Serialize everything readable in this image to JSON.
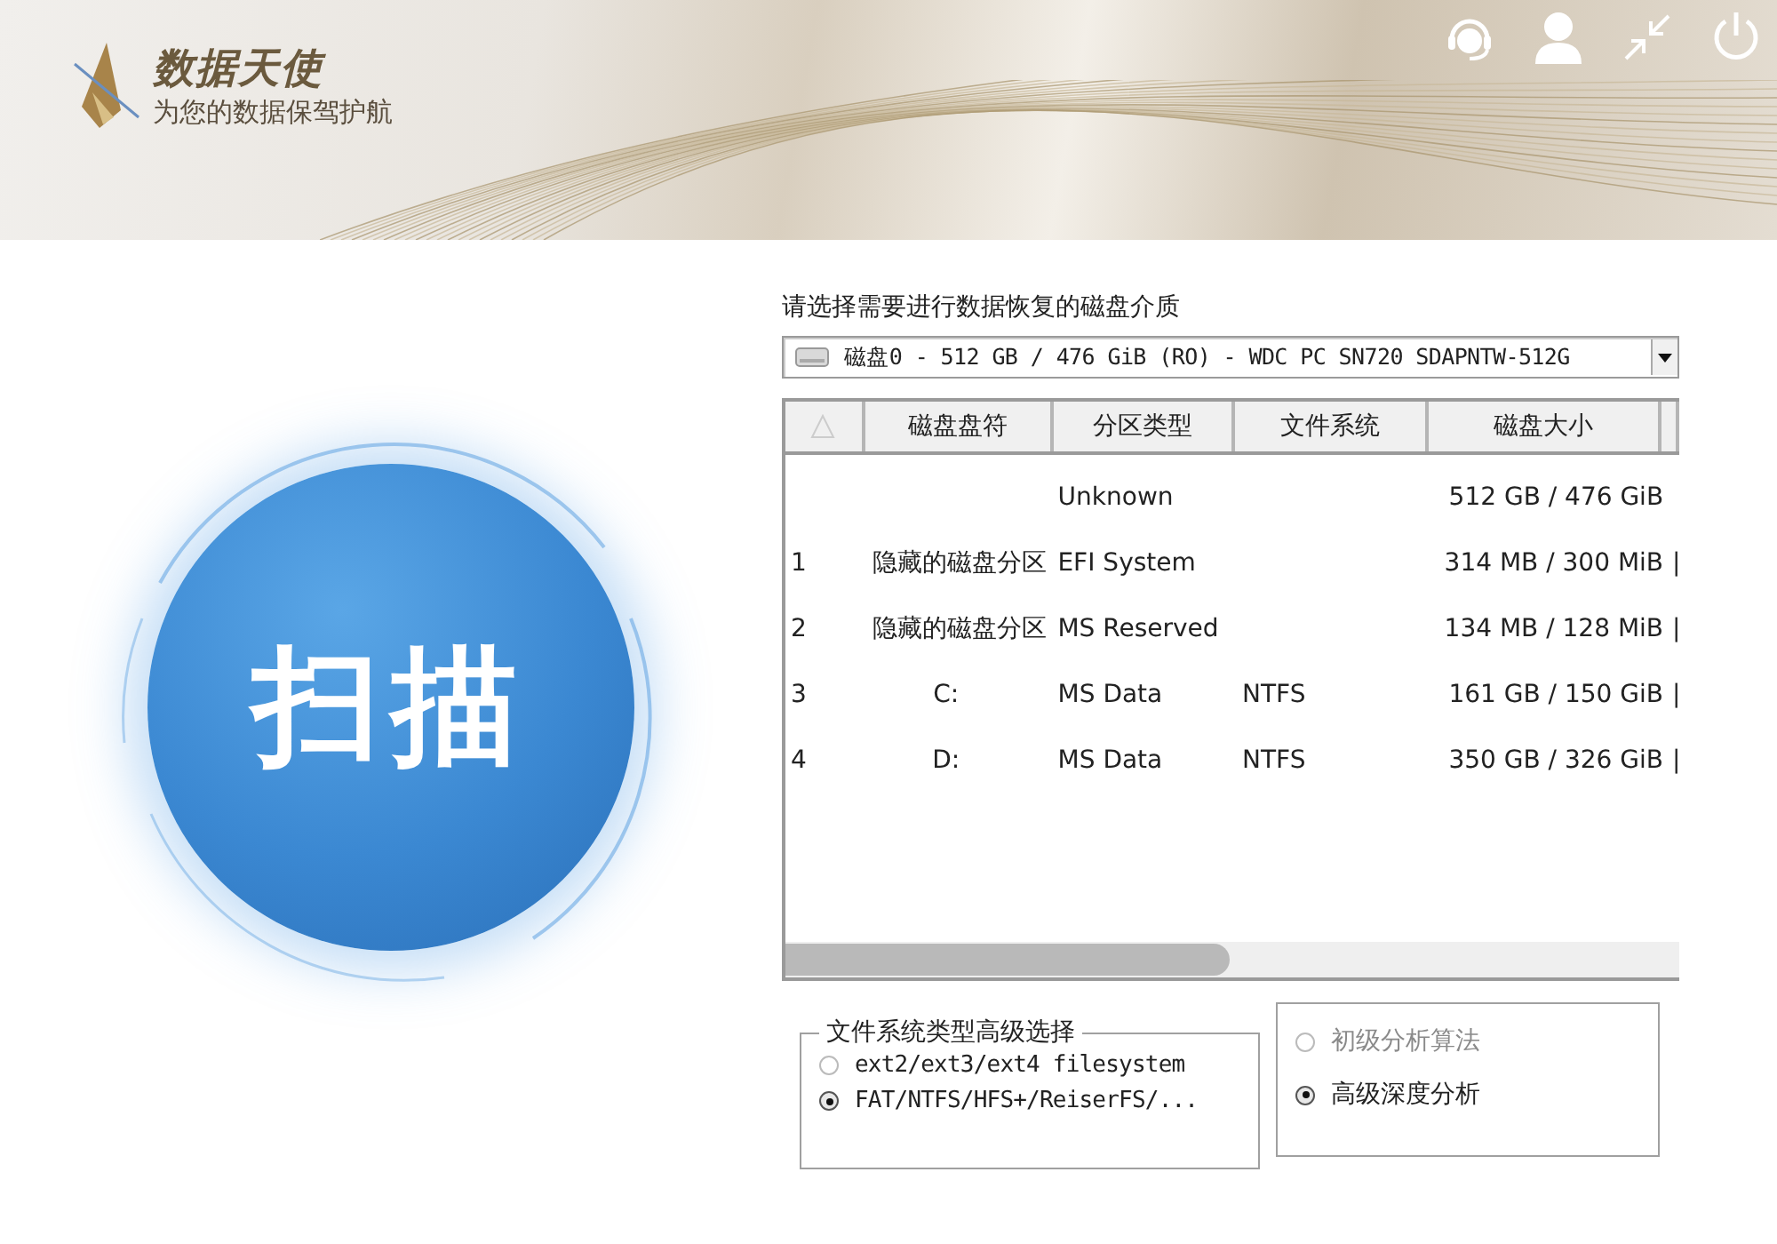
{
  "header": {
    "brand": "数据天使",
    "slogan": "为您的数据保驾护航"
  },
  "scan_button": {
    "label": "扫描"
  },
  "disk_selector": {
    "label": "请选择需要进行数据恢复的磁盘介质",
    "value": "磁盘0 - 512 GB / 476 GiB (RO) - WDC PC SN720 SDAPNTW-512G"
  },
  "table": {
    "columns": [
      "磁盘盘符",
      "分区类型",
      "文件系统",
      "磁盘大小"
    ],
    "rows": [
      {
        "index": "",
        "drive": "",
        "partition_type": "Unknown",
        "filesystem": "",
        "size": "512 GB / 476 GiB",
        "column_6": ""
      },
      {
        "index": "1",
        "drive": "隐藏的磁盘分区",
        "partition_type": "EFI System",
        "filesystem": "",
        "size": "314 MB / 300 MiB",
        "column_6": "|"
      },
      {
        "index": "2",
        "drive": "隐藏的磁盘分区",
        "partition_type": "MS Reserved",
        "filesystem": "",
        "size": "134 MB / 128 MiB",
        "column_6": "|"
      },
      {
        "index": "3",
        "drive": "C:",
        "partition_type": "MS Data",
        "filesystem": "NTFS",
        "size": "161 GB / 150 GiB",
        "column_6": "|"
      },
      {
        "index": "4",
        "drive": "D:",
        "partition_type": "MS Data",
        "filesystem": "NTFS",
        "size": "350 GB / 326 GiB",
        "column_6": "|"
      }
    ]
  },
  "filesystem_options": {
    "legend": "文件系统类型高级选择",
    "options": [
      {
        "label": "ext2/ext3/ext4 filesystem",
        "selected": false
      },
      {
        "label": "FAT/NTFS/HFS+/ReiserFS/...",
        "selected": true
      }
    ]
  },
  "algorithm_options": [
    {
      "label": "初级分析算法",
      "selected": false,
      "disabled": true
    },
    {
      "label": "高级深度分析",
      "selected": true,
      "disabled": false
    }
  ]
}
